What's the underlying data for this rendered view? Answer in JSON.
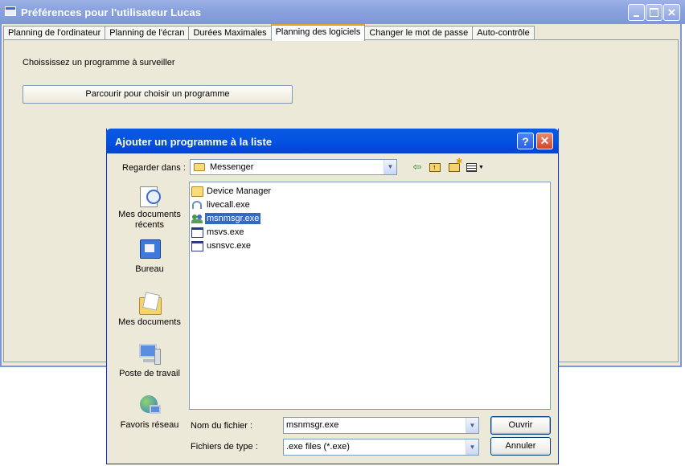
{
  "main_window": {
    "title": "Préférences pour l'utilisateur Lucas",
    "tabs": [
      {
        "label": "Planning de l'ordinateur"
      },
      {
        "label": "Planning de l'écran"
      },
      {
        "label": "Durées Maximales"
      },
      {
        "label": "Planning des logiciels"
      },
      {
        "label": "Changer le mot de passe"
      },
      {
        "label": "Auto-contrôle"
      }
    ],
    "active_tab": "Planning des logiciels",
    "prompt": "Choississez un programme à surveiller",
    "browse_button": "Parcourir pour choisir un programme"
  },
  "dialog": {
    "title": "Ajouter un programme à la liste",
    "look_in_label": "Regarder dans :",
    "look_in_value": "Messenger",
    "places": [
      {
        "label": "Mes documents récents",
        "icon": "recent-documents-icon"
      },
      {
        "label": "Bureau",
        "icon": "desktop-icon"
      },
      {
        "label": "Mes documents",
        "icon": "my-documents-icon"
      },
      {
        "label": "Poste de travail",
        "icon": "my-computer-icon"
      },
      {
        "label": "Favoris réseau",
        "icon": "network-places-icon"
      }
    ],
    "files": [
      {
        "name": "Device Manager",
        "icon": "folder-icon"
      },
      {
        "name": "livecall.exe",
        "icon": "livecall-exe-icon"
      },
      {
        "name": "msnmsgr.exe",
        "icon": "msn-messenger-icon",
        "selected": true
      },
      {
        "name": "msvs.exe",
        "icon": "executable-icon"
      },
      {
        "name": "usnsvc.exe",
        "icon": "executable-icon"
      }
    ],
    "filename_label": "Nom du fichier :",
    "filename_value": "msnmsgr.exe",
    "filetype_label": "Fichiers de type :",
    "filetype_value": ".exe files (*.exe)",
    "open_button": "Ouvrir",
    "cancel_button": "Annuler"
  },
  "colors": {
    "xp_blue": "#0554e3",
    "selection": "#316ac5",
    "face": "#ece9d8",
    "tab_highlight": "#e8a020"
  }
}
